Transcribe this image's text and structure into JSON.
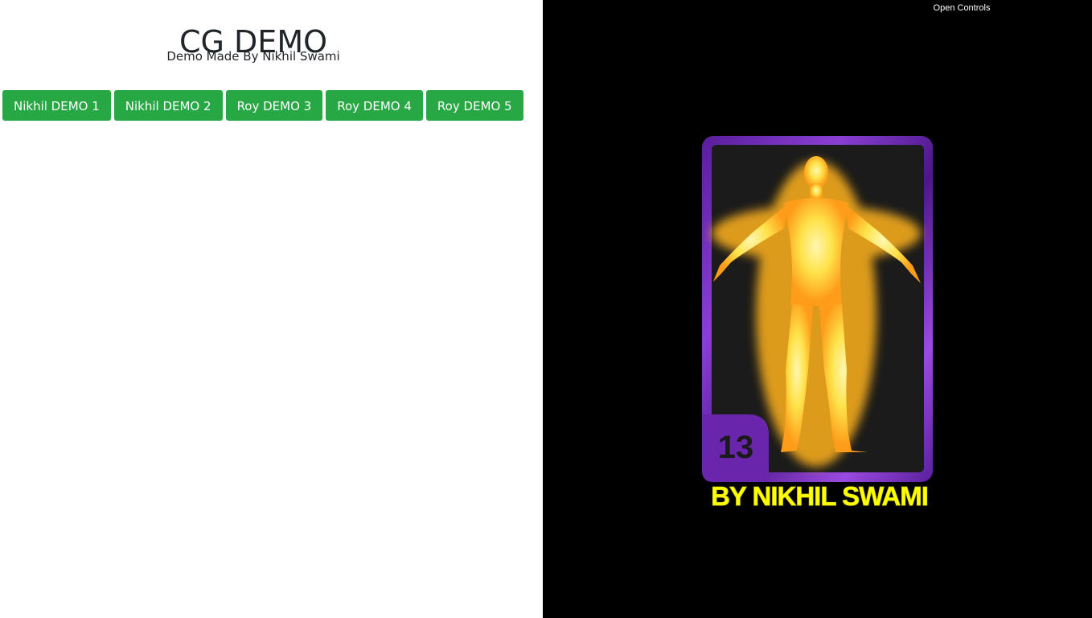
{
  "header": {
    "title": "CG DEMO",
    "subtitle": "Demo Made By Nikhil Swami"
  },
  "buttons": [
    {
      "label": "Nikhil DEMO 1"
    },
    {
      "label": "Nikhil DEMO 2"
    },
    {
      "label": "Roy DEMO 3"
    },
    {
      "label": "Roy DEMO 4"
    },
    {
      "label": "Roy DEMO 5"
    }
  ],
  "viewer": {
    "open_controls_label": "Open Controls",
    "card_number": "13",
    "card_caption": "BY NIKHIL SWAMI"
  },
  "colors": {
    "button_bg": "#28a745",
    "viewer_bg": "#000000",
    "card_frame": "#7b2fbe",
    "figure_glow": "#ffe35a",
    "caption": "#ffff00"
  }
}
